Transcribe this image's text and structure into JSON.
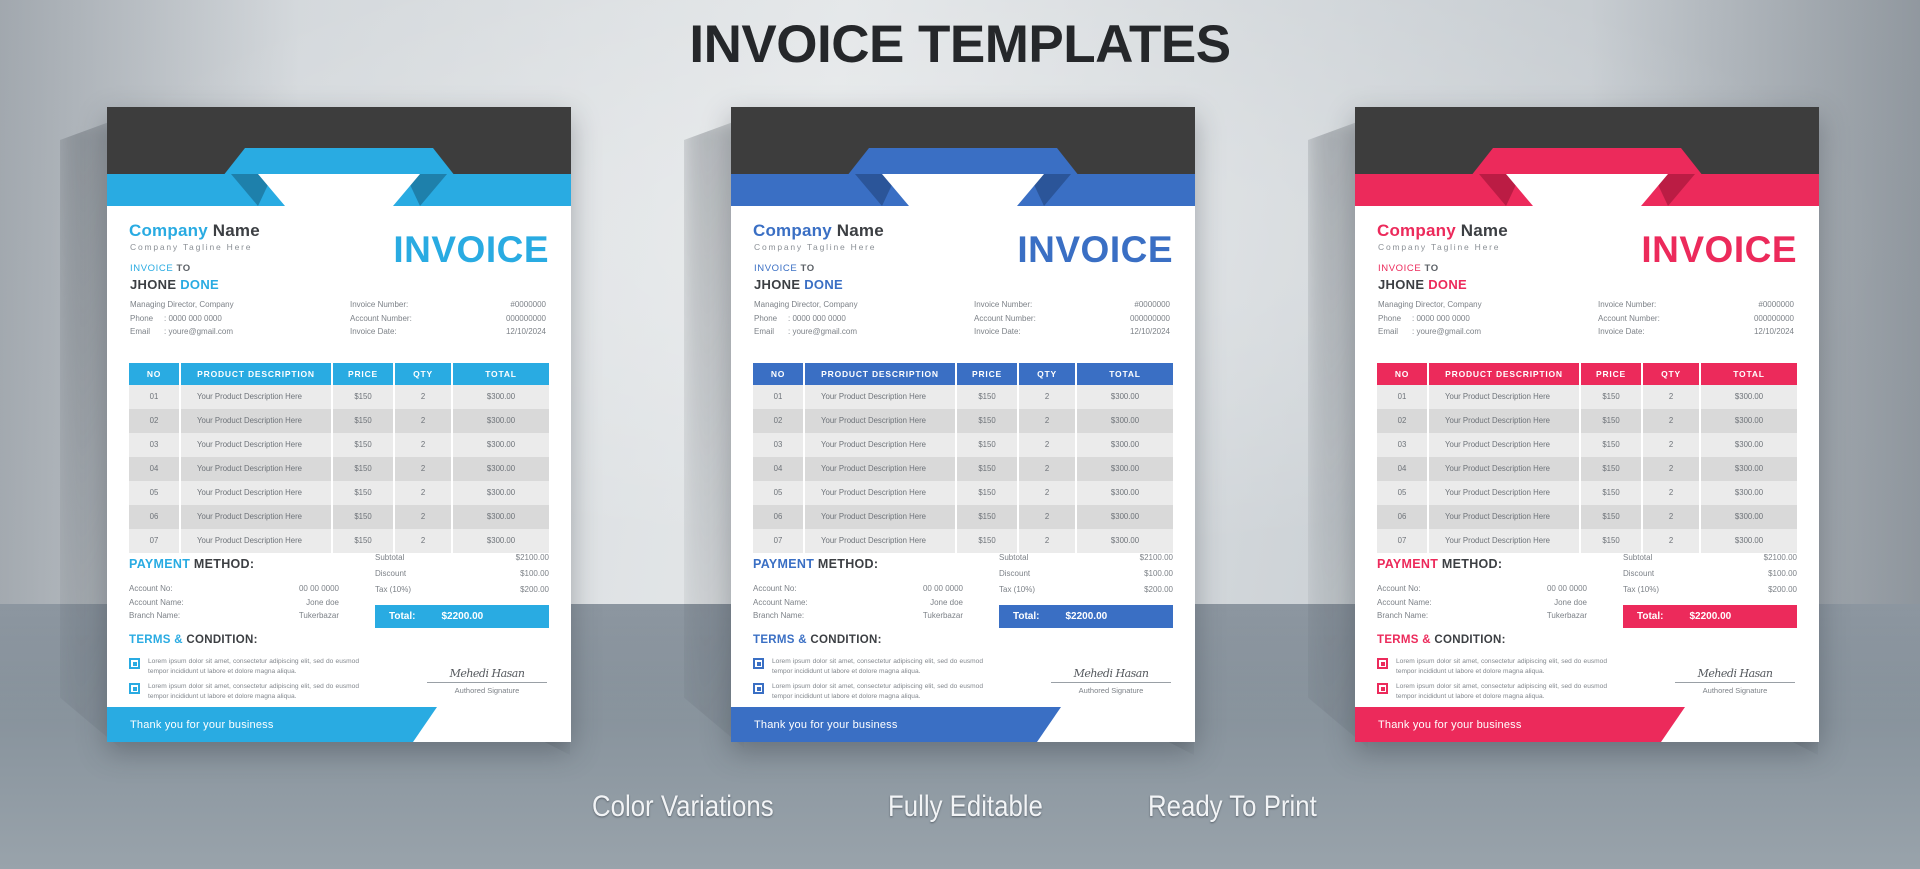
{
  "page": {
    "title": "INVOICE TEMPLATES",
    "captions": [
      "Color Variations",
      "Fully Editable",
      "Ready To Print"
    ]
  },
  "colors": {
    "accent_blue_light": "#29abe2",
    "accent_blue_dark_fold": "#1a6f95",
    "accent_royal": "#3a6fc4",
    "accent_royal_fold": "#254b88",
    "accent_pink": "#ec2a5b",
    "accent_pink_fold": "#a8173c",
    "band_dark": "#3d3d3d",
    "row_light": "#ebebeb",
    "row_dark": "#d9d9d9",
    "text_dark": "#3c3f43",
    "text_muted": "#7d8288",
    "paper": "#ffffff"
  },
  "invoice": {
    "company_name_1": "Company",
    "company_name_2": "Name",
    "tagline": "Company Tagline Here",
    "invoice_to_1": "INVOICE",
    "invoice_to_2": "TO",
    "client_name_1": "JHONE",
    "client_name_2": "DONE",
    "big_title": "INVOICE",
    "contact": [
      {
        "label": "",
        "value": "Managing Director, Company"
      },
      {
        "label": "Phone",
        "value": ": 0000 000 0000"
      },
      {
        "label": "Email",
        "value": ": youre@gmail.com"
      }
    ],
    "meta": [
      {
        "label": "Invoice Number:",
        "value": "#0000000"
      },
      {
        "label": "Account Number:",
        "value": "000000000"
      },
      {
        "label": "Invoice Date:",
        "value": "12/10/2024"
      }
    ],
    "table": {
      "headers": [
        "NO",
        "PRODUCT DESCRIPTION",
        "PRICE",
        "QTY",
        "TOTAL"
      ],
      "rows": [
        [
          "01",
          "Your Product Description Here",
          "$150",
          "2",
          "$300.00"
        ],
        [
          "02",
          "Your Product Description Here",
          "$150",
          "2",
          "$300.00"
        ],
        [
          "03",
          "Your Product Description Here",
          "$150",
          "2",
          "$300.00"
        ],
        [
          "04",
          "Your Product Description Here",
          "$150",
          "2",
          "$300.00"
        ],
        [
          "05",
          "Your Product Description Here",
          "$150",
          "2",
          "$300.00"
        ],
        [
          "06",
          "Your Product Description Here",
          "$150",
          "2",
          "$300.00"
        ],
        [
          "07",
          "Your Product Description Here",
          "$150",
          "2",
          "$300.00"
        ]
      ]
    },
    "payment_title_1": "PAYMENT",
    "payment_title_2": "METHOD:",
    "payment": [
      {
        "label": "Account No:",
        "value": "00 00 0000"
      },
      {
        "label": "Account Name:",
        "value": "Jone doe"
      },
      {
        "label": "Branch Name:",
        "value": "Tukerbazar"
      }
    ],
    "sums": [
      {
        "label": "Subtotal",
        "value": "$2100.00"
      },
      {
        "label": "Discount",
        "value": "$100.00"
      },
      {
        "label": "Tax (10%)",
        "value": "$200.00"
      }
    ],
    "total_label": "Total:",
    "total_value": "$2200.00",
    "terms_title_1": "TERMS &",
    "terms_title_2": "CONDITION:",
    "terms": [
      "Lorem ipsum dolor sit amet, consectetur adipiscing elit, sed do eusmod tempor incididunt ut labore et dolore magna aliqua.",
      "Lorem ipsum dolor sit amet, consectetur adipiscing elit, sed do eusmod tempor incididunt ut labore et dolore magna aliqua."
    ],
    "signature_mark": "Mehedi Hasan",
    "signature_label": "Authored Signature",
    "footer_text": "Thank  you for your business"
  },
  "variants": [
    {
      "name": "light-blue",
      "accent": "#29abe2",
      "fold": "#1a6f95"
    },
    {
      "name": "royal-blue",
      "accent": "#3a6fc4",
      "fold": "#254b88"
    },
    {
      "name": "crimson-pink",
      "accent": "#ec2a5b",
      "fold": "#a8173c"
    }
  ]
}
